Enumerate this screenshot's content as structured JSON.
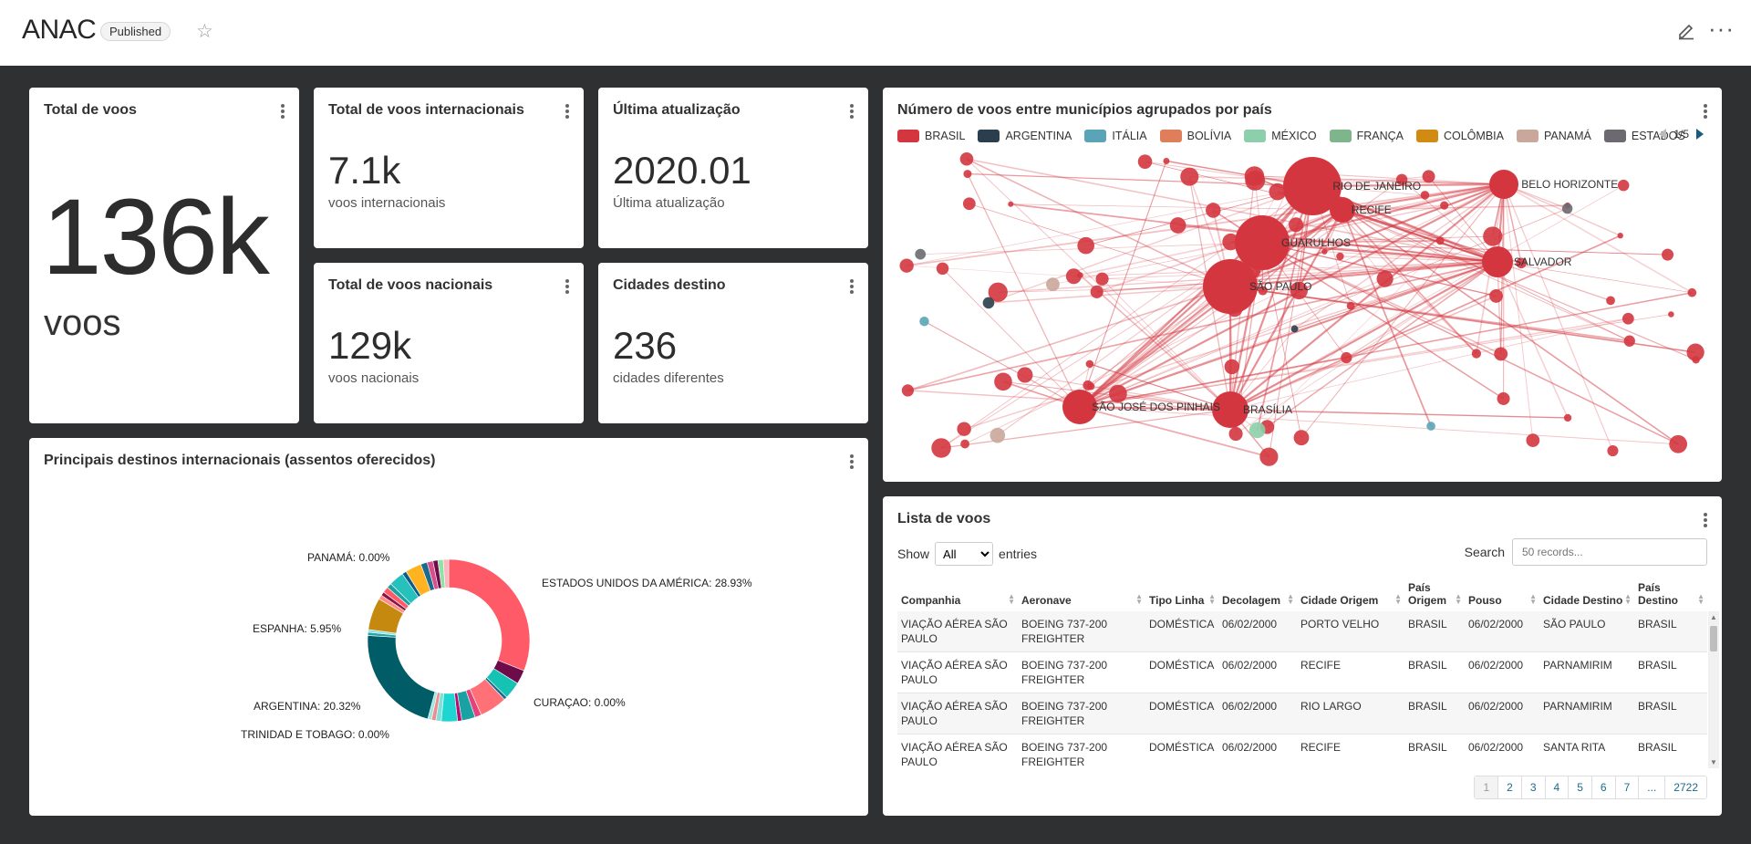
{
  "header": {
    "title": "ANAC",
    "badge": "Published"
  },
  "cards": {
    "total": {
      "title": "Total de voos",
      "value": "136k",
      "sub": "voos"
    },
    "intl": {
      "title": "Total de voos internacionais",
      "value": "7.1k",
      "sub": "voos internacionais"
    },
    "update": {
      "title": "Última atualização",
      "value": "2020.01",
      "sub": "Última atualização"
    },
    "nacional": {
      "title": "Total de voos nacionais",
      "value": "129k",
      "sub": "voos nacionais"
    },
    "cidades": {
      "title": "Cidades destino",
      "value": "236",
      "sub": "cidades diferentes"
    }
  },
  "graph": {
    "title": "Número de voos entre municípios agrupados por país",
    "legend": [
      {
        "label": "BRASIL",
        "color": "#d4363f"
      },
      {
        "label": "ARGENTINA",
        "color": "#2b3e4d"
      },
      {
        "label": "ITÁLIA",
        "color": "#5aa4b8"
      },
      {
        "label": "BOLÍVIA",
        "color": "#e07d5a"
      },
      {
        "label": "MÉXICO",
        "color": "#8ccfaa"
      },
      {
        "label": "FRANÇA",
        "color": "#7fb58a"
      },
      {
        "label": "COLÔMBIA",
        "color": "#d18a12"
      },
      {
        "label": "PANAMÁ",
        "color": "#c9a79a"
      },
      {
        "label": "ESTADOS",
        "color": "#6c6a70"
      }
    ],
    "page": "1/5",
    "cities": [
      {
        "name": "RIO DE JANEIRO"
      },
      {
        "name": "BELO HORIZONTE"
      },
      {
        "name": "RECIFE"
      },
      {
        "name": "GUARULHOS"
      },
      {
        "name": "SALVADOR"
      },
      {
        "name": "SÃO PAULO"
      },
      {
        "name": "BRASÍLIA"
      },
      {
        "name": "SÃO JOSÉ DOS PINHAIS"
      }
    ]
  },
  "pie": {
    "title": "Principais destinos internacionais (assentos oferecidos)",
    "labels": [
      "PANAMÁ: 0.00%",
      "ESTADOS UNIDOS DA AMÉRICA: 28.93%",
      "ESPANHA: 5.95%",
      "CURAÇAO: 0.00%",
      "ARGENTINA: 20.32%",
      "TRINIDAD E TOBAGO: 0.00%"
    ]
  },
  "chart_data": {
    "type": "pie",
    "title": "Principais destinos internacionais (assentos oferecidos)",
    "categories": [
      "ESTADOS UNIDOS DA AMÉRICA",
      "ARGENTINA",
      "ESPANHA",
      "PANAMÁ",
      "CURAÇAO",
      "TRINIDAD E TOBAGO"
    ],
    "values": [
      28.93,
      20.32,
      5.95,
      0.0,
      0.0,
      0.0
    ]
  },
  "table": {
    "title": "Lista de voos",
    "show_label": "Show",
    "show_value": "All",
    "entries_label": "entries",
    "search_label": "Search",
    "search_placeholder": "50 records...",
    "columns": [
      "Companhia",
      "Aeronave",
      "Tipo Linha",
      "Decolagem",
      "Cidade Origem",
      "País Origem",
      "Pouso",
      "Cidade Destino",
      "País Destino"
    ],
    "rows": [
      [
        "VIAÇÃO AÉREA SÃO PAULO",
        "BOEING 737-200 FREIGHTER",
        "DOMÉSTICA",
        "06/02/2000",
        "PORTO VELHO",
        "BRASIL",
        "06/02/2000",
        "SÃO PAULO",
        "BRASIL"
      ],
      [
        "VIAÇÃO AÉREA SÃO PAULO",
        "BOEING 737-200 FREIGHTER",
        "DOMÉSTICA",
        "06/02/2000",
        "RECIFE",
        "BRASIL",
        "06/02/2000",
        "PARNAMIRIM",
        "BRASIL"
      ],
      [
        "VIAÇÃO AÉREA SÃO PAULO",
        "BOEING 737-200 FREIGHTER",
        "DOMÉSTICA",
        "06/02/2000",
        "RIO LARGO",
        "BRASIL",
        "06/02/2000",
        "PARNAMIRIM",
        "BRASIL"
      ],
      [
        "VIAÇÃO AÉREA SÃO PAULO",
        "BOEING 737-200 FREIGHTER",
        "DOMÉSTICA",
        "06/02/2000",
        "RECIFE",
        "BRASIL",
        "06/02/2000",
        "SANTA RITA",
        "BRASIL"
      ]
    ],
    "pages": [
      "1",
      "2",
      "3",
      "4",
      "5",
      "6",
      "7",
      "...",
      "2722"
    ]
  }
}
